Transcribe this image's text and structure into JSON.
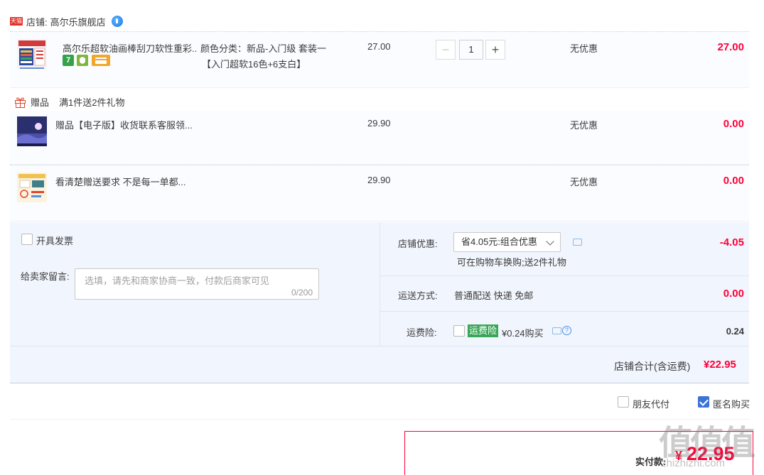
{
  "shop": {
    "prefix": "店铺:",
    "name": "高尔乐旗舰店",
    "logo_text": "天猫"
  },
  "main_item": {
    "title": "高尔乐超软油画棒刮刀软性重彩...",
    "sku_line1": "颜色分类：新品-入门级 套装一",
    "sku_line2": "【入门超软16色+6支白】",
    "unit_price": "27.00",
    "quantity": "1",
    "discount": "无优惠",
    "total": "27.00",
    "badge_7": "7"
  },
  "gift_section": {
    "label": "赠品",
    "rule": "满1件送2件礼物"
  },
  "gifts": [
    {
      "title": "赠品【电子版】收货联系客服领...",
      "unit_price": "29.90",
      "discount": "无优惠",
      "total": "0.00"
    },
    {
      "title": "看清楚赠送要求 不是每一单都...",
      "unit_price": "29.90",
      "discount": "无优惠",
      "total": "0.00"
    }
  ],
  "invoice": {
    "label": "开具发票"
  },
  "message": {
    "label": "给卖家留言:",
    "placeholder": "选填，请先和商家协商一致，付款后商家可见",
    "counter": "0/200"
  },
  "store_discount": {
    "label": "店铺优惠:",
    "selected": "省4.05元:组合优惠",
    "note": "可在购物车换购;送2件礼物",
    "amount": "-4.05"
  },
  "shipping": {
    "label": "运送方式:",
    "value": "普通配送 快递 免邮",
    "amount": "0.00"
  },
  "insurance": {
    "label": "运费险:",
    "tag": "运费险",
    "price_text": "¥0.24购买",
    "amount": "0.24"
  },
  "store_total": {
    "label": "店铺合计(含运费)",
    "amount": "¥22.95"
  },
  "options": {
    "friend_pay": "朋友代付",
    "anonymous": "匿名购买"
  },
  "payment": {
    "label": "实付款:",
    "currency": "¥",
    "amount": "22.95"
  },
  "watermark": {
    "text": "值值值",
    "sub": "zhizhizhi.com"
  },
  "colors": {
    "accent_red": "#ff0036",
    "checkbox_blue": "#3b73d8",
    "green_tag": "#3aa657"
  }
}
